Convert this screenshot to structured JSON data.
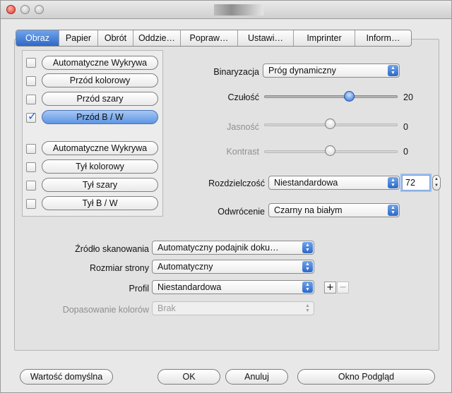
{
  "tabs": [
    "Obraz",
    "Papier",
    "Obrót",
    "Oddzie…",
    "Popraw…",
    "Ustawi…",
    "Imprinter",
    "Inform…"
  ],
  "scan_types": [
    {
      "label": "Automatyczne Wykrywa",
      "checked": false,
      "selected": false
    },
    {
      "label": "Przód kolorowy",
      "checked": false,
      "selected": false
    },
    {
      "label": "Przód szary",
      "checked": false,
      "selected": false
    },
    {
      "label": "Przód B / W",
      "checked": true,
      "selected": true
    },
    {
      "label": "Automatyczne Wykrywa",
      "checked": false,
      "selected": false
    },
    {
      "label": "Tył kolorowy",
      "checked": false,
      "selected": false
    },
    {
      "label": "Tył szary",
      "checked": false,
      "selected": false
    },
    {
      "label": "Tył B / W",
      "checked": false,
      "selected": false
    }
  ],
  "binarization": {
    "label": "Binaryzacja",
    "value": "Próg dynamiczny"
  },
  "sensitivity": {
    "label": "Czułość",
    "value": "20"
  },
  "brightness": {
    "label": "Jasność",
    "value": "0"
  },
  "contrast": {
    "label": "Kontrast",
    "value": "0"
  },
  "resolution": {
    "label": "Rozdzielczość",
    "value": "Niestandardowa",
    "dpi": "72"
  },
  "inversion": {
    "label": "Odwrócenie",
    "value": "Czarny na białym"
  },
  "scan_source": {
    "label": "Źródło skanowania",
    "value": "Automatyczny podajnik doku…"
  },
  "page_size": {
    "label": "Rozmiar strony",
    "value": "Automatyczny"
  },
  "profile": {
    "label": "Profil",
    "value": "Niestandardowa",
    "add": "+",
    "remove": "−"
  },
  "color_matching": {
    "label": "Dopasowanie kolorów",
    "value": "Brak"
  },
  "buttons": {
    "defaults": "Wartość domyślna",
    "ok": "OK",
    "cancel": "Anuluj",
    "preview": "Okno Podgląd"
  }
}
